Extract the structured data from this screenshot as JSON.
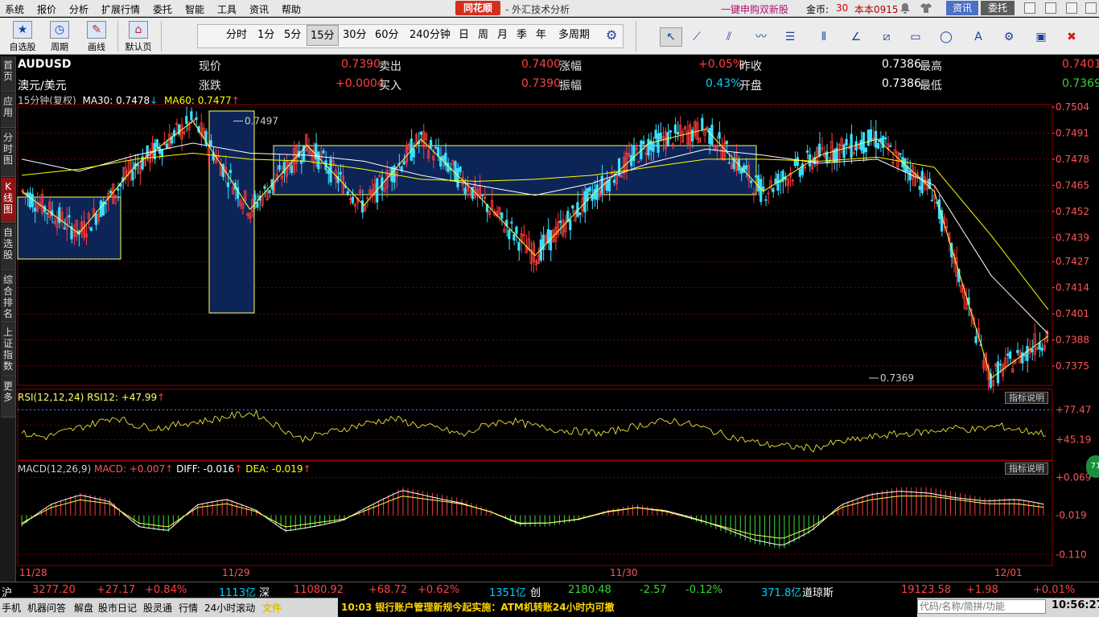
{
  "menu": {
    "items": [
      "系统",
      "报价",
      "分析",
      "扩展行情",
      "委托",
      "智能",
      "工具",
      "资讯",
      "帮助"
    ],
    "logo": "同花顺",
    "subtitle": "- 外汇技术分析",
    "promo": "一键申购双新股",
    "coins_label": "金币:",
    "coins_value": "30",
    "version": "本本0915",
    "info_button": "资讯",
    "trust_button": "委托"
  },
  "toolbar": {
    "buttons": [
      "自选股",
      "周期",
      "画线",
      "默认页"
    ],
    "periods": [
      "分时",
      "1分",
      "5分",
      "15分",
      "30分",
      "60分",
      "240分钟",
      "日",
      "周",
      "月",
      "季",
      "年",
      "多周期"
    ],
    "active_period": "15分"
  },
  "sidebar": {
    "tabs": [
      "首页",
      "应用",
      "分时图",
      "K线图",
      "自选股",
      "综合排名",
      "上证指数",
      "更多"
    ],
    "active": "K线图"
  },
  "quote": {
    "symbol": "AUDUSD",
    "name": "澳元/美元",
    "labels": {
      "current": "现价",
      "change": "涨跌",
      "sell": "卖出",
      "buy": "买入",
      "pct": "涨幅",
      "amp": "振幅",
      "prev": "昨收",
      "open": "开盘",
      "high": "最高",
      "low": "最低"
    },
    "current": "0.7390",
    "change": "+0.0004",
    "sell": "0.7400",
    "buy": "0.7390",
    "pct": "+0.05%",
    "amp": "0.43%",
    "prev": "0.7386",
    "open": "0.7386",
    "high": "0.7401",
    "low": "0.7369"
  },
  "ma_legend": {
    "period": "15分钟(复权)",
    "ma30": "MA30: 0.7478",
    "ma60": "MA60: 0.7477"
  },
  "chart_data": {
    "type": "candlestick",
    "y_ticks": [
      "0.7504",
      "0.7491",
      "0.7478",
      "0.7465",
      "0.7452",
      "0.7439",
      "0.7427",
      "0.7414",
      "0.7401",
      "0.7388",
      "0.7375"
    ],
    "ylim": [
      0.7369,
      0.7504
    ],
    "x_labels": [
      "11/28",
      "11/29",
      "11/30",
      "12/01"
    ],
    "annotations": [
      {
        "label": "0.7497"
      },
      {
        "label": "0.7369"
      }
    ],
    "series": [
      {
        "name": "价格",
        "kind": "zigzag",
        "values": [
          0.7462,
          0.7441,
          0.7475,
          0.7497,
          0.7453,
          0.7485,
          0.7455,
          0.7488,
          0.746,
          0.743,
          0.746,
          0.7486,
          0.7493,
          0.7462,
          0.748,
          0.7488,
          0.7462,
          0.7369,
          0.739
        ]
      },
      {
        "name": "MA30",
        "kind": "line",
        "values": [
          0.7478,
          0.7472,
          0.748,
          0.7486,
          0.7481,
          0.748,
          0.7477,
          0.747,
          0.7465,
          0.746,
          0.7466,
          0.7476,
          0.7483,
          0.748,
          0.7476,
          0.7478,
          0.7465,
          0.742,
          0.7391
        ]
      },
      {
        "name": "MA60",
        "kind": "line",
        "values": [
          0.747,
          0.7473,
          0.7478,
          0.7481,
          0.7478,
          0.7477,
          0.7473,
          0.7468,
          0.7467,
          0.7468,
          0.747,
          0.7474,
          0.7478,
          0.7478,
          0.7477,
          0.7479,
          0.7474,
          0.744,
          0.7403
        ]
      }
    ],
    "grid": true
  },
  "rsi": {
    "legend": "RSI(12,12,24)  RSI12: +47.99",
    "ticks": [
      "+77.47",
      "+45.19"
    ],
    "help": "指标说明",
    "values": [
      52,
      48,
      55,
      62,
      70,
      60,
      58,
      63,
      66,
      71,
      74,
      60,
      46,
      52,
      58,
      64,
      68,
      61,
      57,
      50,
      62,
      66,
      60,
      56,
      54,
      52,
      58,
      63,
      66,
      60,
      52,
      45,
      40,
      38,
      36,
      42,
      46,
      50,
      52,
      54,
      58,
      56,
      60,
      55,
      52
    ]
  },
  "macd": {
    "legend_label": "MACD(12,26,9)",
    "legend_macd": "MACD: +0.007",
    "legend_diff": "DIFF: -0.016",
    "legend_dea": "DEA: -0.019",
    "ticks": [
      "+0.069",
      "-0.019",
      "-0.110"
    ],
    "help": "指标说明",
    "hist": [
      -0.02,
      0.02,
      0.04,
      0.03,
      -0.02,
      -0.03,
      0.02,
      0.03,
      0.01,
      -0.03,
      -0.02,
      -0.01,
      0.02,
      0.05,
      0.04,
      0.03,
      0.01,
      -0.02,
      -0.02,
      -0.01,
      0.01,
      0.02,
      0.01,
      -0.01,
      -0.03,
      -0.05,
      -0.06,
      -0.03,
      0.02,
      0.04,
      0.05,
      0.05,
      0.04,
      0.03,
      0.03,
      0.02
    ]
  },
  "ticker": {
    "sh_label": "沪",
    "sh_value": "3277.20",
    "sh_change": "+27.17",
    "sh_pct": "+0.84%",
    "sh_vol": "1113亿",
    "sz_label": "深",
    "sz_value": "11080.92",
    "sz_change": "+68.72",
    "sz_pct": "+0.62%",
    "sz_vol": "1351亿",
    "cy_label": "创",
    "cy_value": "2180.48",
    "cy_change": "-2.57",
    "cy_pct": "-0.12%",
    "cy_vol": "371.8亿",
    "dj_label": "道琼斯",
    "dj_value": "19123.58",
    "dj_change": "+1.98",
    "dj_pct": "+0.01%"
  },
  "status": {
    "items": [
      "手机",
      "机器问答",
      "解盘",
      "股市日记",
      "股灵通",
      "行情",
      "24小时滚动"
    ],
    "file": "文件",
    "news": "10:03 银行账户管理新规今起实施：ATM机转账24小时内可撤",
    "search_placeholder": "代码/名称/简拼/功能",
    "clock": "10:56:27"
  },
  "badge": "71"
}
